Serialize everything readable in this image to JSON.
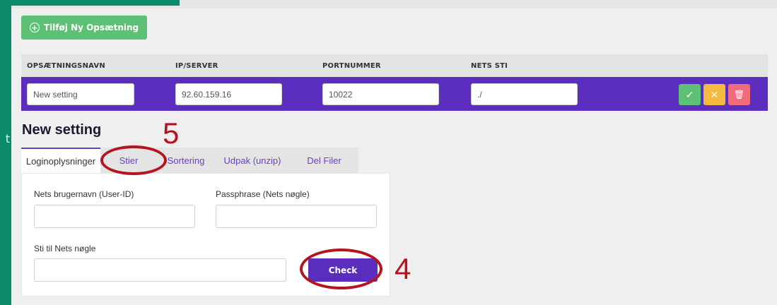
{
  "stray_char": "t",
  "toolbar": {
    "add_label": "Tilføj Ny Opsætning",
    "add_icon": "plus-circle-icon"
  },
  "table": {
    "headers": [
      "OPSÆTNINGSNAVN",
      "IP/SERVER",
      "PORTNUMMER",
      "NETS STI"
    ],
    "row": {
      "name": "New setting",
      "server": "92.60.159.16",
      "port": "10022",
      "path": "./"
    },
    "actions": {
      "ok": "✓",
      "cancel": "✕",
      "delete": "🗑"
    }
  },
  "setting": {
    "title": "New setting"
  },
  "tabs": [
    "Loginoplysninger",
    "Stier",
    "Sortering",
    "Udpak (unzip)",
    "Del Filer"
  ],
  "form": {
    "user_label": "Nets brugernavn (User-ID)",
    "pass_label": "Passphrase (Nets nøgle)",
    "key_label": "Sti til Nets nøgle",
    "check_label": "Check"
  },
  "annotations": {
    "n5": "5",
    "n4": "4"
  },
  "colors": {
    "green_sidebar": "#0b8a6c",
    "purple": "#5b2ebf",
    "green_button": "#5cc174",
    "annotation_red": "#b3141e"
  }
}
